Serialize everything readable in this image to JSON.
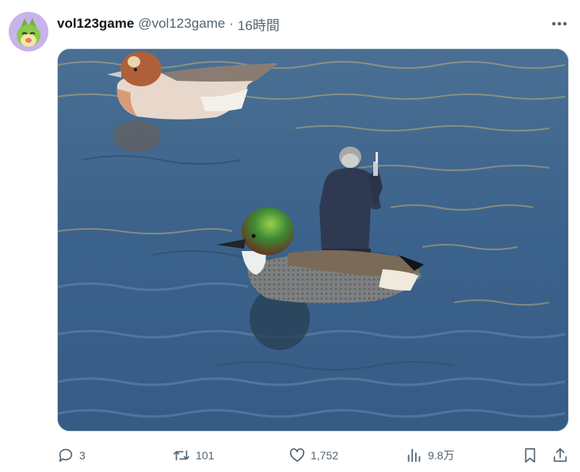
{
  "post": {
    "display_name": "vol123game",
    "handle": "@vol123game",
    "separator": "·",
    "time": "16時間",
    "avatar_icon": "green-creature-avatar-icon",
    "more_icon": "more-options-icon"
  },
  "media": {
    "subject": "duck-photo-with-edited-fisherman"
  },
  "actions": {
    "replies": "3",
    "reposts": "101",
    "likes": "1,752",
    "views": "9.8万",
    "icons": [
      "reply-icon",
      "repost-icon",
      "like-icon",
      "views-icon",
      "bookmark-icon",
      "share-icon"
    ]
  },
  "colors": {
    "text_primary": "#0f1419",
    "text_secondary": "#536471",
    "water": "#3a5f85"
  }
}
